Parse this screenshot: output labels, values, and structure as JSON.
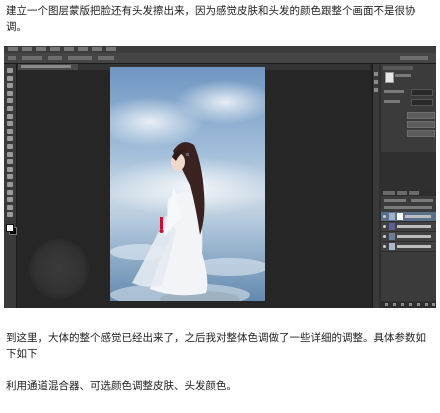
{
  "article": {
    "para1": "建立一个图层蒙版把脸还有头发擦出来，因为感觉皮肤和头发的颜色跟整个画面不是很协调。",
    "para2": "到这里，大体的整个感觉已经出来了，之后我对整体色调做了一些详细的调整。具体参数如下如下",
    "para3": "利用通道混合器、可选颜色调整皮肤、头发颜色。"
  },
  "photoshop": {
    "theme_colors": {
      "ui_dark": "#282828",
      "panel": "#3b3b3b",
      "selected_layer": "#5a6f8c"
    },
    "tools": [
      "move-icon",
      "marquee-icon",
      "lasso-icon",
      "quick-select-icon",
      "crop-icon",
      "eyedropper-icon",
      "healing-icon",
      "brush-icon",
      "clone-stamp-icon",
      "history-brush-icon",
      "eraser-icon",
      "gradient-icon",
      "blur-icon",
      "dodge-icon",
      "pen-icon",
      "type-icon",
      "path-select-icon",
      "shape-icon",
      "hand-icon",
      "zoom-icon"
    ],
    "layers": [
      {
        "thumb_color": "#9fb4c8",
        "has_mask": true,
        "selected": true
      },
      {
        "thumb_color": "#5a5f9a",
        "has_mask": false,
        "selected": false
      },
      {
        "thumb_color": "#6d7d96",
        "has_mask": false,
        "selected": false
      },
      {
        "thumb_color": "#a9b8c8",
        "has_mask": false,
        "selected": false
      }
    ]
  }
}
